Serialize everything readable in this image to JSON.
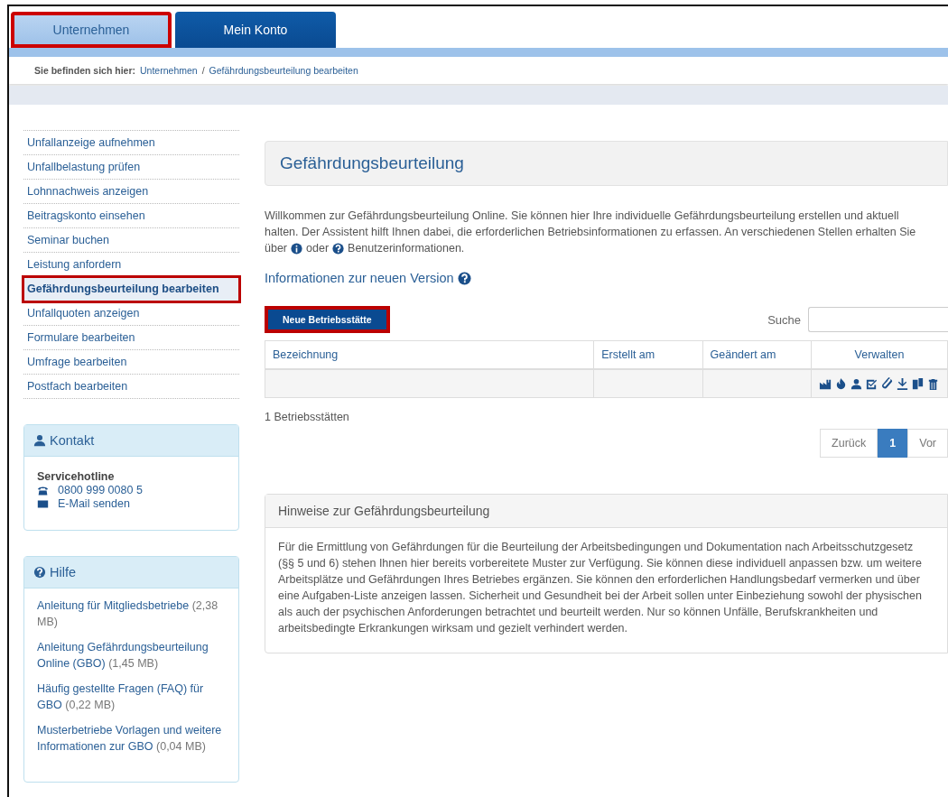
{
  "tabs": [
    {
      "label": "Unternehmen",
      "selected": true,
      "highlighted": true
    },
    {
      "label": "Mein Konto",
      "selected": false,
      "highlighted": false
    }
  ],
  "breadcrumb": {
    "label": "Sie befinden sich hier:",
    "items": [
      "Unternehmen",
      "Gefährdungsbeurteilung bearbeiten"
    ],
    "separator": "/"
  },
  "sidebar": {
    "items": [
      {
        "label": "Unfallanzeige aufnehmen",
        "selected": false,
        "highlighted": false
      },
      {
        "label": "Unfallbelastung prüfen",
        "selected": false,
        "highlighted": false
      },
      {
        "label": "Lohnnachweis anzeigen",
        "selected": false,
        "highlighted": false
      },
      {
        "label": "Beitragskonto einsehen",
        "selected": false,
        "highlighted": false
      },
      {
        "label": "Seminar buchen",
        "selected": false,
        "highlighted": false
      },
      {
        "label": "Leistung anfordern",
        "selected": false,
        "highlighted": false
      },
      {
        "label": "Gefährdungsbeurteilung bearbeiten",
        "selected": true,
        "highlighted": true
      },
      {
        "label": "Unfallquoten anzeigen",
        "selected": false,
        "highlighted": false
      },
      {
        "label": "Formulare bearbeiten",
        "selected": false,
        "highlighted": false
      },
      {
        "label": "Umfrage bearbeiten",
        "selected": false,
        "highlighted": false
      },
      {
        "label": "Postfach bearbeiten",
        "selected": false,
        "highlighted": false
      }
    ],
    "contact": {
      "title": "Kontakt",
      "heading": "Servicehotline",
      "phone": "0800 999 0080 5",
      "email": "E-Mail senden"
    },
    "help": {
      "title": "Hilfe",
      "links": [
        {
          "label": "Anleitung  für Mitgliedsbetriebe",
          "size": "(2,38 MB)"
        },
        {
          "label": "Anleitung  Gefährdungsbeurteilung Online (GBO)",
          "size": "(1,45 MB)"
        },
        {
          "label": "Häufig gestellte Fragen (FAQ) für GBO",
          "size": "(0,22 MB)"
        },
        {
          "label": "Musterbetriebe Vorlagen und weitere Informationen zur GBO",
          "size": "(0,04 MB)"
        }
      ]
    }
  },
  "main": {
    "title": "Gefährdungsbeurteilung",
    "intro": [
      "Willkommen zur Gefährdungsbeurteilung Online. Sie können hier Ihre individuelle Gefährdungsbeurteilung erstellen und aktuell halten. Der Assistent hilft Ihnen dabei, die erforderlichen Betriebsinformationen zu erfassen. An verschiedenen Stellen erhalten Sie",
      "über",
      "oder",
      "Benutzerinformationen."
    ],
    "version_link": "Informationen zur neuen Version",
    "new_button": {
      "label": "Neue Betriebsstätte",
      "highlighted": true
    },
    "search": {
      "label": "Suche"
    },
    "table": {
      "columns": [
        "Bezeichnung",
        "Erstellt am",
        "Geändert am",
        "Verwalten"
      ],
      "rows": [
        {
          "cells": [
            "",
            "",
            ""
          ]
        }
      ]
    },
    "count": "1 Betriebsstätten",
    "pagination": [
      {
        "label": "Zurück",
        "selected": false
      },
      {
        "label": "1",
        "selected": true
      },
      {
        "label": "Vor",
        "selected": false
      }
    ],
    "notes": {
      "title": "Hinweise zur Gefährdungsbeurteilung",
      "text": "Für die Ermittlung von Gefährdungen für die Beurteilung der Arbeitsbedingungen und Dokumentation nach Arbeitsschutzgesetz (§§ 5 und 6) stehen Ihnen hier bereits vorbereitete Muster zur Verfügung. Sie können diese individuell anpassen bzw. um weitere Arbeitsplätze und Gefährdungen Ihres Betriebes ergänzen. Sie können den erforderlichen Handlungsbedarf vermerken und über eine Aufgaben-Liste anzeigen lassen. Sicherheit und Gesundheit bei der Arbeit sollen unter Einbeziehung sowohl der physischen als auch der psychischen Anforderungen betrachtet und beurteilt werden. Nur so können Unfälle, Berufskrankheiten und arbeitsbedingte Erkrankungen wirksam und gezielt verhindert werden."
    }
  }
}
